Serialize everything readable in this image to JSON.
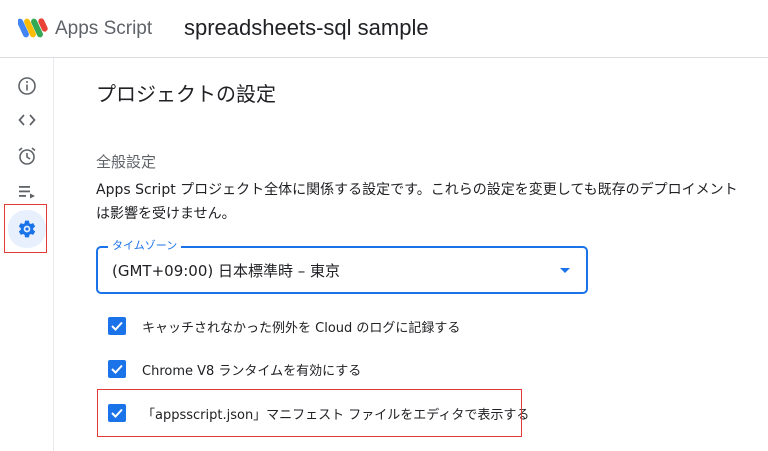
{
  "header": {
    "app_name": "Apps Script",
    "project_title": "spreadsheets-sql sample",
    "logo_icon": "apps-script-logo"
  },
  "sidebar": {
    "items": [
      {
        "icon": "info-icon",
        "label": "Overview"
      },
      {
        "icon": "code-icon",
        "label": "Editor"
      },
      {
        "icon": "alarm-icon",
        "label": "Triggers"
      },
      {
        "icon": "executions-icon",
        "label": "Executions"
      },
      {
        "icon": "gear-icon",
        "label": "Project Settings",
        "active": true
      }
    ]
  },
  "main": {
    "page_title": "プロジェクトの設定",
    "section_title": "全般設定",
    "description": "Apps Script プロジェクト全体に関係する設定です。これらの設定を変更しても既存のデプロイメントは影響を受けません。",
    "timezone": {
      "label": "タイムゾーン",
      "value": "(GMT+09:00) 日本標準時 – 東京"
    },
    "checkboxes": [
      {
        "label": "キャッチされなかった例外を Cloud のログに記録する",
        "checked": true
      },
      {
        "label": "Chrome V8 ランタイムを有効にする",
        "checked": true
      },
      {
        "label": "「appsscript.json」マニフェスト ファイルをエディタで表示する",
        "checked": true
      }
    ]
  },
  "colors": {
    "accent": "#1a73e8",
    "highlight": "#e53935"
  }
}
